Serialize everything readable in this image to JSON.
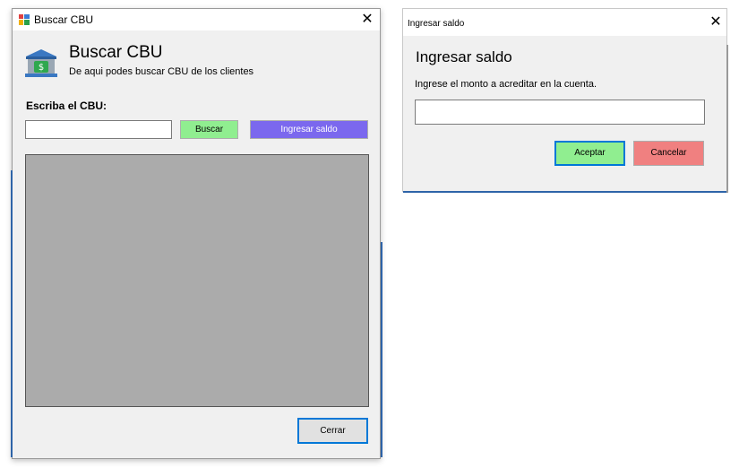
{
  "buscar_window": {
    "title": "Buscar CBU",
    "close_label": "✕",
    "header": {
      "title": "Buscar CBU",
      "subtitle": "De aqui podes buscar CBU de los clientes"
    },
    "cbu_label": "Escriba el CBU:",
    "cbu_input_value": "",
    "buscar_button": "Buscar",
    "ingresar_saldo_button": "Ingresar saldo",
    "cerrar_button": "Cerrar",
    "colors": {
      "buscar_bg": "#90ee90",
      "ingresar_bg": "#7b68ee",
      "grid_bg": "#ababab"
    }
  },
  "saldo_dialog": {
    "title": "Ingresar saldo",
    "close_label": "✕",
    "heading": "Ingresar saldo",
    "message": "Ingrese el monto a acreditar en la cuenta.",
    "monto_input_value": "",
    "aceptar_button": "Aceptar",
    "cancelar_button": "Cancelar",
    "colors": {
      "aceptar_bg": "#90ee90",
      "cancelar_bg": "#f08080"
    }
  }
}
